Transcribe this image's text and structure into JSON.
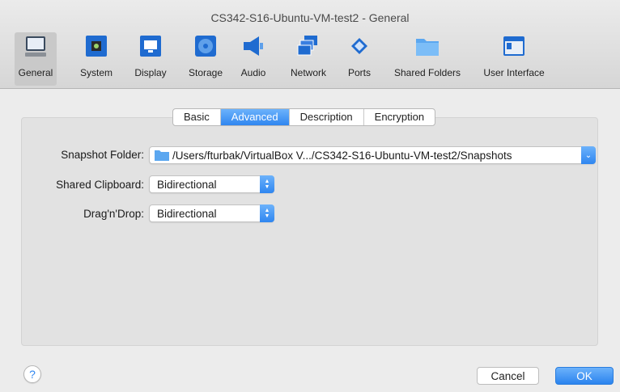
{
  "window": {
    "title": "CS342-S16-Ubuntu-VM-test2 - General"
  },
  "toolbar": {
    "items": [
      {
        "label": "General",
        "icon": "monitor-icon",
        "selected": true
      },
      {
        "label": "System",
        "icon": "chip-icon"
      },
      {
        "label": "Display",
        "icon": "display-icon"
      },
      {
        "label": "Storage",
        "icon": "disk-icon"
      },
      {
        "label": "Audio",
        "icon": "speaker-icon"
      },
      {
        "label": "Network",
        "icon": "network-icon"
      },
      {
        "label": "Ports",
        "icon": "plug-icon"
      },
      {
        "label": "Shared Folders",
        "icon": "folder-icon"
      },
      {
        "label": "User Interface",
        "icon": "window-icon"
      }
    ]
  },
  "tabs": [
    {
      "label": "Basic"
    },
    {
      "label": "Advanced",
      "active": true
    },
    {
      "label": "Description"
    },
    {
      "label": "Encryption"
    }
  ],
  "form": {
    "snapshot_label": "Snapshot Folder:",
    "snapshot_value": "/Users/fturbak/VirtualBox V.../CS342-S16-Ubuntu-VM-test2/Snapshots",
    "clipboard_label": "Shared Clipboard:",
    "clipboard_value": "Bidirectional",
    "dragdrop_label": "Drag'n'Drop:",
    "dragdrop_value": "Bidirectional"
  },
  "buttons": {
    "help": "?",
    "cancel": "Cancel",
    "ok": "OK"
  },
  "colors": {
    "accent": "#2f86f0"
  }
}
